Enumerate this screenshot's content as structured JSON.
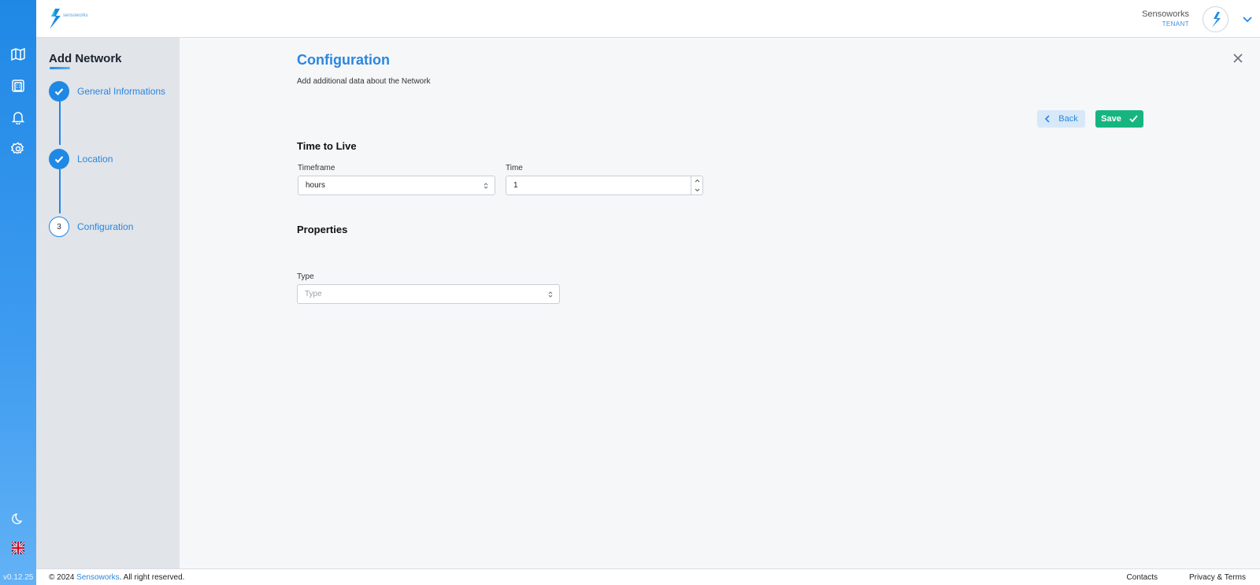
{
  "app": {
    "version": "v0.12.25",
    "colors": {
      "primary": "#1f88e5",
      "success": "#16b57f",
      "stepper_bg": "#e1e4e9"
    }
  },
  "rail": {
    "icons": [
      "map-icon",
      "building-icon",
      "bell-icon",
      "gear-icon",
      "moon-icon",
      "uk-flag-icon"
    ]
  },
  "header": {
    "logo_text": "sensoworks",
    "user_name": "Sensoworks",
    "user_role": "TENANT"
  },
  "stepper": {
    "title": "Add Network",
    "steps": [
      {
        "label": "General Informations",
        "state": "done"
      },
      {
        "label": "Location",
        "state": "done"
      },
      {
        "label": "Configuration",
        "state": "current",
        "number": "3"
      }
    ]
  },
  "main": {
    "title": "Configuration",
    "subtitle": "Add additional data about the Network",
    "back_label": "Back",
    "save_label": "Save",
    "ttl": {
      "title": "Time to Live",
      "timeframe_label": "Timeframe",
      "timeframe_value": "hours",
      "time_label": "Time",
      "time_value": "1"
    },
    "properties": {
      "title": "Properties",
      "type_label": "Type",
      "type_placeholder": "Type"
    }
  },
  "footer": {
    "copyright_prefix": "© 2024 ",
    "company": "Sensoworks",
    "copyright_suffix": ". All right reserved.",
    "contacts": "Contacts",
    "privacy": "Privacy & Terms"
  }
}
